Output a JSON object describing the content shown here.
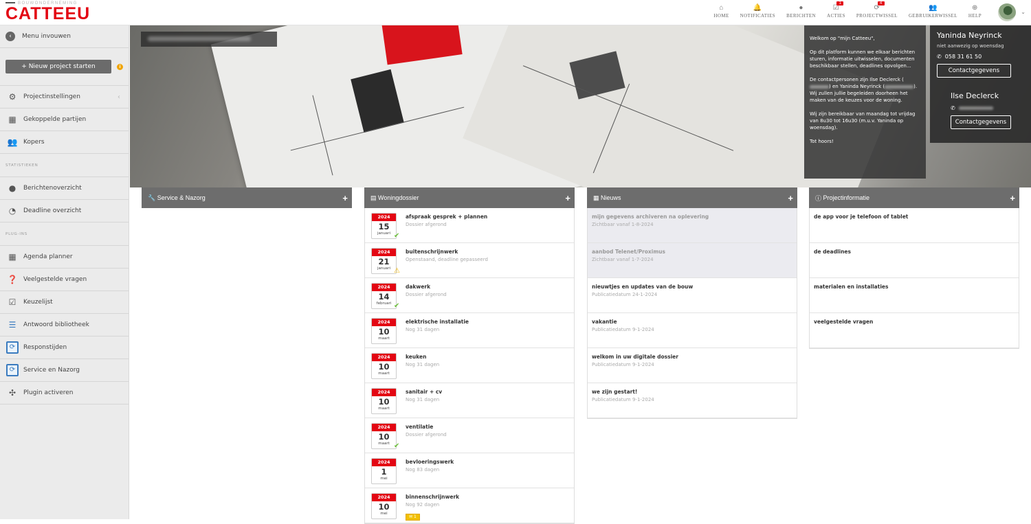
{
  "header": {
    "logo_sub": "BOUWONDERNEMING",
    "logo_main": "CATTEEU",
    "nav": [
      {
        "label": "HOME",
        "icon": "home-icon",
        "glyph": "⌂",
        "badge": ""
      },
      {
        "label": "NOTIFICATIES",
        "icon": "bell-icon",
        "glyph": "🔔",
        "badge": ""
      },
      {
        "label": "BERICHTEN",
        "icon": "comment-icon",
        "glyph": "●",
        "badge": ""
      },
      {
        "label": "ACTIES",
        "icon": "check-square-icon",
        "glyph": "☑",
        "badge": "1"
      },
      {
        "label": "PROJECTWISSEL",
        "icon": "refresh-icon",
        "glyph": "⟳",
        "badge": "4"
      },
      {
        "label": "GEBRUIKERWISSEL",
        "icon": "users-icon",
        "glyph": "👥",
        "badge": ""
      },
      {
        "label": "HELP",
        "icon": "lifebuoy-icon",
        "glyph": "⊕",
        "badge": ""
      }
    ]
  },
  "sidebar": {
    "back": "Menu invouwen",
    "new_project": "+ Nieuw project starten",
    "items_top": [
      "Projectinstellingen",
      "Gekoppelde partijen",
      "Kopers"
    ],
    "section_stats": "STATISTIEKEN",
    "items_stats": [
      "Berichtenoverzicht",
      "Deadline overzicht"
    ],
    "section_plugins": "PLUG-INS",
    "items_plugins": [
      "Agenda planner",
      "Veelgestelde vragen",
      "Keuzelijst",
      "Antwoord bibliotheek",
      "Responstijden",
      "Service en Nazorg",
      "Plugin activeren"
    ]
  },
  "welcome": {
    "p1": "Welkom op \"mijn Catteeu\",",
    "p2": "Op dit platform kunnen we elkaar berichten sturen, informatie uitwisselen, documenten beschikbaar stellen, deadlines opvolgen...",
    "p3a": "De contactpersonen zijn Ilse Declerck (",
    "p3b": ") en Yaninda Neyrinck (",
    "p3c": "). Wij zullen jullie begeleiden doorheen het maken van de keuzes voor de woning.",
    "p4": "Wij zijn bereikbaar van maandag tot vrijdag van 8u30 tot 16u30 (m.u.v. Yaninda op woensdag).",
    "p5": "Tot hoors!"
  },
  "contacts": [
    {
      "name": "Yaninda Neyrinck",
      "status": "niet aanwezig op woensdag",
      "phone": "058 31 61 50",
      "button": "Contactgegevens"
    },
    {
      "name": "Ilse Declerck",
      "status": "",
      "phone": "",
      "button": "Contactgegevens"
    }
  ],
  "panels": {
    "service": {
      "title": "Service & Nazorg"
    },
    "woning": {
      "title": "Woningdossier",
      "items": [
        {
          "year": "2024",
          "day": "15",
          "month": "januari",
          "title": "afspraak gesprek + plannen",
          "sub": "Dossier afgerond",
          "status": "ok"
        },
        {
          "year": "2024",
          "day": "21",
          "month": "januari",
          "title": "buitenschrijnwerk",
          "sub": "Openstaand, deadline gepasseerd",
          "status": "warn"
        },
        {
          "year": "2024",
          "day": "14",
          "month": "februari",
          "title": "dakwerk",
          "sub": "Dossier afgerond",
          "status": "ok"
        },
        {
          "year": "2024",
          "day": "10",
          "month": "maart",
          "title": "elektrische installatie",
          "sub": "Nog 31 dagen",
          "status": ""
        },
        {
          "year": "2024",
          "day": "10",
          "month": "maart",
          "title": "keuken",
          "sub": "Nog 31 dagen",
          "status": ""
        },
        {
          "year": "2024",
          "day": "10",
          "month": "maart",
          "title": "sanitair + cv",
          "sub": "Nog 31 dagen",
          "status": ""
        },
        {
          "year": "2024",
          "day": "10",
          "month": "maart",
          "title": "ventilatie",
          "sub": "Dossier afgerond",
          "status": "ok"
        },
        {
          "year": "2024",
          "day": "1",
          "month": "mei",
          "title": "bevloeringswerk",
          "sub": "Nog 83 dagen",
          "status": ""
        },
        {
          "year": "2024",
          "day": "10",
          "month": "mei",
          "title": "binnenschrijnwerk",
          "sub": "Nog 92 dagen",
          "status": "",
          "extra": "1"
        }
      ]
    },
    "nieuws": {
      "title": "Nieuws",
      "items": [
        {
          "title": "mijn gegevens archiveren na oplevering",
          "sub": "Zichtbaar vanaf 1-8-2024",
          "faded": true
        },
        {
          "title": "aanbod Telenet/Proximus",
          "sub": "Zichtbaar vanaf 1-7-2024",
          "faded": true
        },
        {
          "title": "nieuwtjes en updates van de bouw",
          "sub": "Publicatiedatum 24-1-2024",
          "faded": false
        },
        {
          "title": "vakantie",
          "sub": "Publicatiedatum 9-1-2024",
          "faded": false
        },
        {
          "title": "welkom in uw digitale dossier",
          "sub": "Publicatiedatum 9-1-2024",
          "faded": false
        },
        {
          "title": "we zijn gestart!",
          "sub": "Publicatiedatum 9-1-2024",
          "faded": false
        }
      ]
    },
    "project": {
      "title": "Projectinformatie",
      "items": [
        "de app voor je telefoon of tablet",
        "de deadlines",
        "materialen en installaties",
        "veelgestelde vragen"
      ]
    }
  }
}
